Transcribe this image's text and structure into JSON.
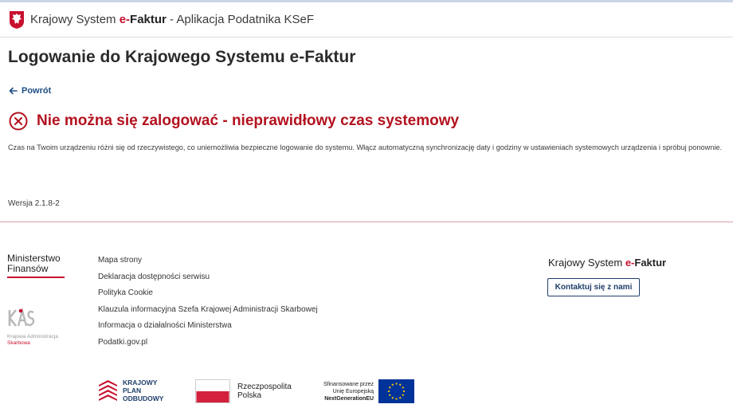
{
  "header": {
    "title_prefix": "Krajowy System ",
    "brand_e": "e-",
    "brand_faktur": "Faktur",
    "title_suffix": " - Aplikacja Podatnika KSeF"
  },
  "main": {
    "page_title": "Logowanie do Krajowego Systemu e-Faktur",
    "back_label": "Powrót",
    "error_title": "Nie można się zalogować - nieprawidłowy czas systemowy",
    "error_description": "Czas na Twoim urządzeniu różni się od rzeczywistego, co uniemożliwia bezpieczne logowanie do systemu. Włącz automatyczną synchronizację daty i godziny w ustawieniach systemowych urządzenia i spróbuj ponownie.",
    "version": "Wersja 2.1.8-2"
  },
  "footer": {
    "ministry_line1": "Ministerstwo",
    "ministry_line2": "Finansów",
    "kas_line1": "Krajowa Administracja",
    "kas_line2": "Skarbowa",
    "links": [
      "Mapa strony",
      "Deklaracja dostępności serwisu",
      "Polityka Cookie",
      "Klauzula informacyjna Szefa Krajowej Administracji Skarbowej",
      "Informacja o działalności Ministerstwa",
      "Podatki.gov.pl"
    ],
    "brand_prefix": "Krajowy System ",
    "brand_e": "e-",
    "brand_faktur": "Faktur",
    "contact_label": "Kontaktuj się z nami",
    "kpo_line1": "KRAJOWY",
    "kpo_line2": "PLAN",
    "kpo_line3": "ODBUDOWY",
    "rp_line1": "Rzeczpospolita",
    "rp_line2": "Polska",
    "eu_line1": "Sfinansowane przez",
    "eu_line2": "Unię Europejską",
    "eu_line3": "NextGenerationEU"
  },
  "colors": {
    "accent_red": "#c8102e",
    "error_red": "#b3121f",
    "navy": "#1f3f6b"
  }
}
